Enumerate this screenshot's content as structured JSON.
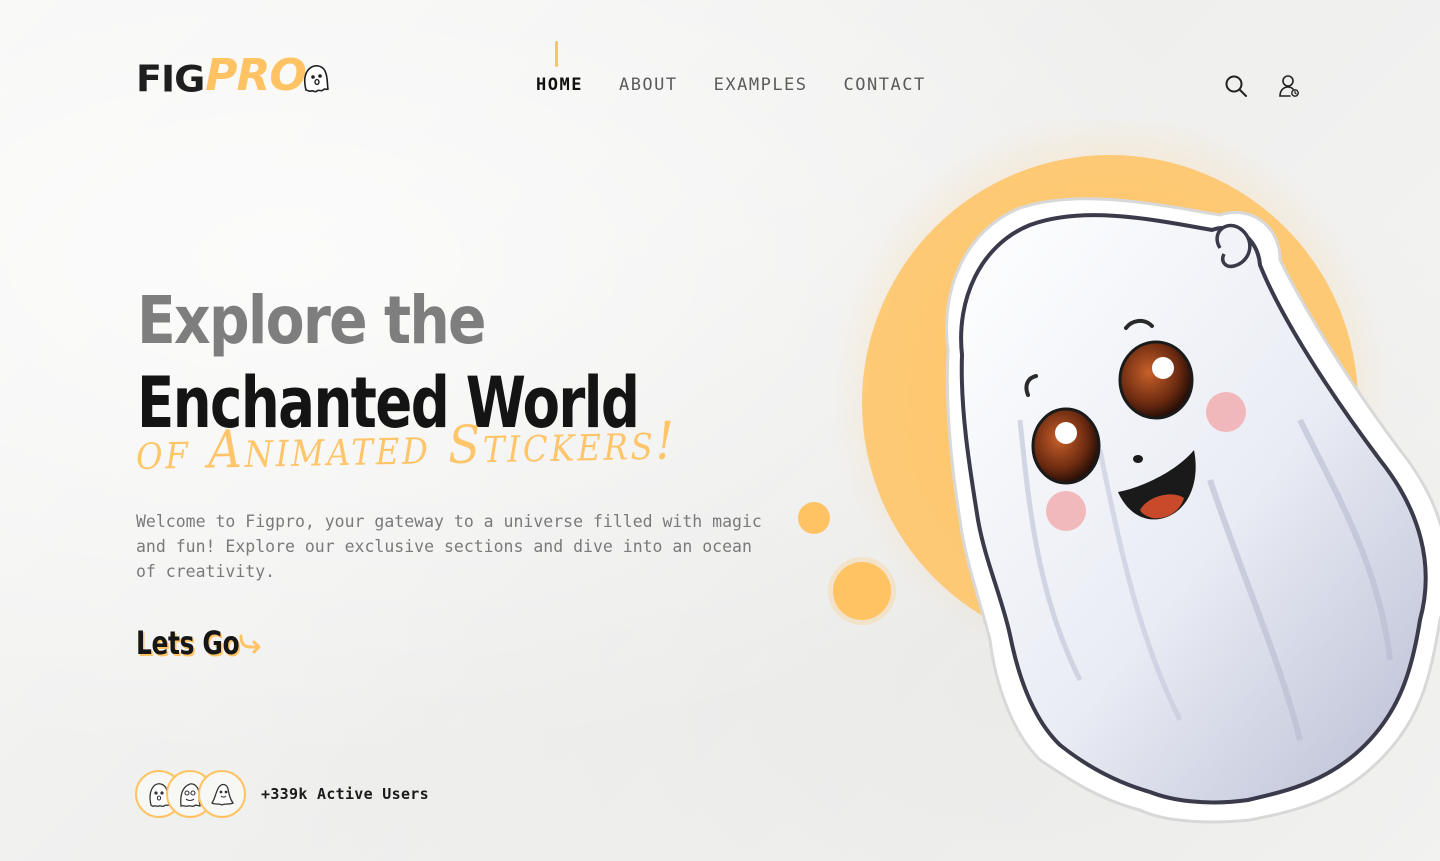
{
  "brand": {
    "fig": "FIG",
    "pro": "PRO",
    "accent_color": "#ffc363",
    "logo_icon": "ghost-icon"
  },
  "nav": {
    "items": [
      {
        "label": "HOME",
        "active": true
      },
      {
        "label": "ABOUT",
        "active": false
      },
      {
        "label": "EXAMPLES",
        "active": false
      },
      {
        "label": "CONTACT",
        "active": false
      }
    ]
  },
  "header_icons": {
    "search": "search-icon",
    "user": "user-icon"
  },
  "hero": {
    "line1": "Explore the",
    "line2": "Enchanted World",
    "line3": "of Animated Stickers!",
    "description": "Welcome to Figpro, your gateway to a universe filled with magic and fun! Explore our exclusive sections and dive into an ocean of creativity.",
    "cta_label": "Lets Go",
    "cta_icon": "arrow-right-icon"
  },
  "users": {
    "text": "+339k Active Users",
    "avatar_icons": [
      "ghost-icon",
      "ghost-icon",
      "ghost-icon"
    ]
  },
  "colors": {
    "text_dark": "#141414",
    "text_gray": "#7e7e7e",
    "accent": "#ffc363"
  }
}
